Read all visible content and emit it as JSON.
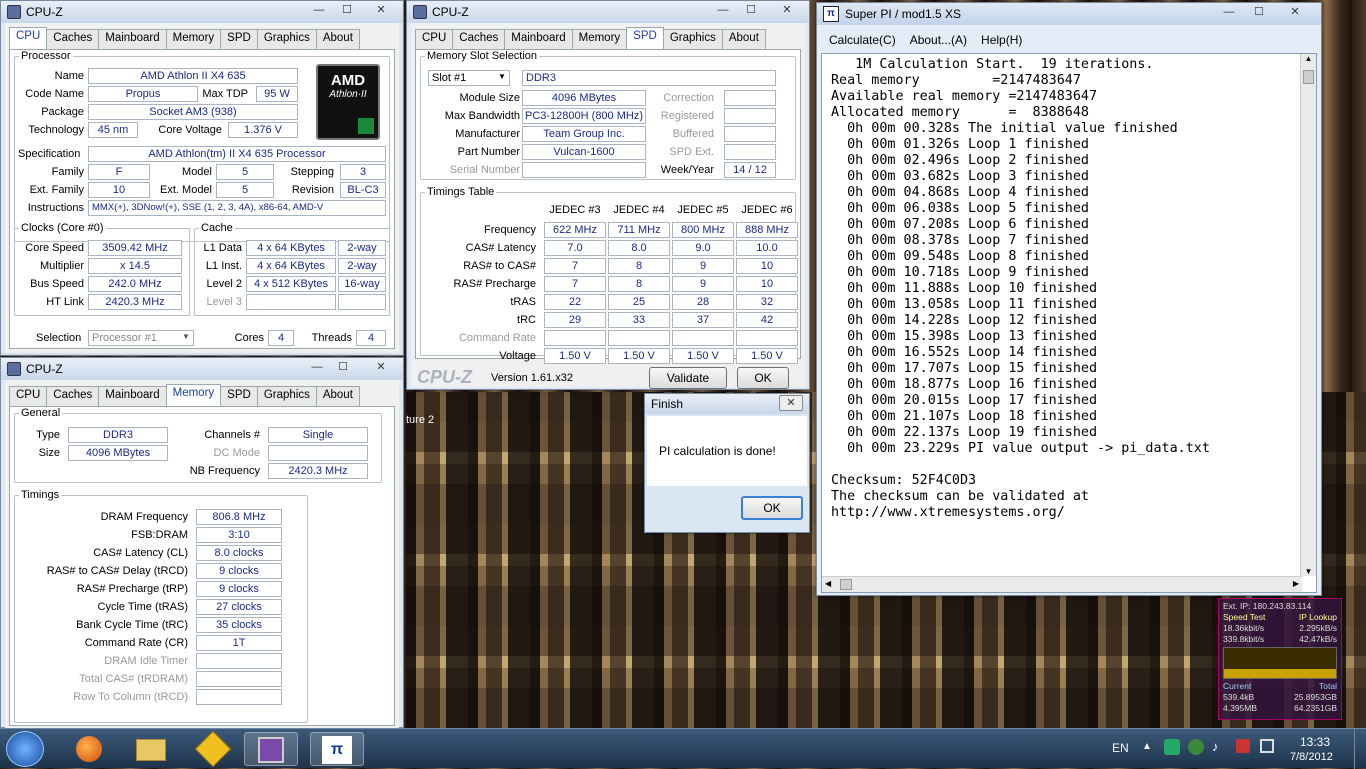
{
  "cpuz1": {
    "title": "CPU-Z",
    "tabs": [
      "CPU",
      "Caches",
      "Mainboard",
      "Memory",
      "SPD",
      "Graphics",
      "About"
    ],
    "active_tab": "CPU",
    "processor_legend": "Processor",
    "name_label": "Name",
    "name": "AMD Athlon II X4 635",
    "codename_label": "Code Name",
    "codename": "Propus",
    "maxtdp_label": "Max TDP",
    "maxtdp": "95 W",
    "package_label": "Package",
    "package": "Socket AM3 (938)",
    "technology_label": "Technology",
    "technology": "45 nm",
    "corevoltage_label": "Core Voltage",
    "corevoltage": "1.376 V",
    "spec_label": "Specification",
    "spec": "AMD Athlon(tm) II X4 635 Processor",
    "family_label": "Family",
    "family": "F",
    "model_label": "Model",
    "model": "5",
    "stepping_label": "Stepping",
    "stepping": "3",
    "extfamily_label": "Ext. Family",
    "extfamily": "10",
    "extmodel_label": "Ext. Model",
    "extmodel": "5",
    "revision_label": "Revision",
    "revision": "BL-C3",
    "instructions_label": "Instructions",
    "instructions": "MMX(+), 3DNow!(+), SSE (1, 2, 3, 4A), x86-64, AMD-V",
    "logo_brand": "AMD",
    "logo_sub": "Athlon·II",
    "clocks_legend": "Clocks (Core #0)",
    "corespeed_label": "Core Speed",
    "corespeed": "3509.42 MHz",
    "multiplier_label": "Multiplier",
    "multiplier": "x 14.5",
    "busspeed_label": "Bus Speed",
    "busspeed": "242.0 MHz",
    "htlink_label": "HT Link",
    "htlink": "2420.3 MHz",
    "cache_legend": "Cache",
    "l1data_label": "L1 Data",
    "l1data": "4 x 64 KBytes",
    "l1data_way": "2-way",
    "l1inst_label": "L1 Inst.",
    "l1inst": "4 x 64 KBytes",
    "l1inst_way": "2-way",
    "level2_label": "Level 2",
    "level2": "4 x 512 KBytes",
    "level2_way": "16-way",
    "level3_label": "Level 3",
    "selection_label": "Selection",
    "selection": "Processor #1",
    "cores_label": "Cores",
    "cores": "4",
    "threads_label": "Threads",
    "threads": "4"
  },
  "cpuz2": {
    "title": "CPU-Z",
    "tabs": [
      "CPU",
      "Caches",
      "Mainboard",
      "Memory",
      "SPD",
      "Graphics",
      "About"
    ],
    "active_tab": "SPD",
    "slot_legend": "Memory Slot Selection",
    "slot": "Slot #1",
    "slot_type": "DDR3",
    "modulesize_label": "Module Size",
    "modulesize": "4096 MBytes",
    "correction_label": "Correction",
    "maxbw_label": "Max Bandwidth",
    "maxbw": "PC3-12800H (800 MHz)",
    "registered_label": "Registered",
    "manufacturer_label": "Manufacturer",
    "manufacturer": "Team Group Inc.",
    "buffered_label": "Buffered",
    "partnumber_label": "Part Number",
    "partnumber": "Vulcan-1600",
    "spdext_label": "SPD Ext.",
    "serial_label": "Serial Number",
    "weekyear_label": "Week/Year",
    "weekyear": "14 / 12",
    "timings_legend": "Timings Table",
    "jedec_headers": [
      "JEDEC #3",
      "JEDEC #4",
      "JEDEC #5",
      "JEDEC #6"
    ],
    "rows": [
      {
        "label": "Frequency",
        "vals": [
          "622 MHz",
          "711 MHz",
          "800 MHz",
          "888 MHz"
        ]
      },
      {
        "label": "CAS# Latency",
        "vals": [
          "7.0",
          "8.0",
          "9.0",
          "10.0"
        ]
      },
      {
        "label": "RAS# to CAS#",
        "vals": [
          "7",
          "8",
          "9",
          "10"
        ]
      },
      {
        "label": "RAS# Precharge",
        "vals": [
          "7",
          "8",
          "9",
          "10"
        ]
      },
      {
        "label": "tRAS",
        "vals": [
          "22",
          "25",
          "28",
          "32"
        ]
      },
      {
        "label": "tRC",
        "vals": [
          "29",
          "33",
          "37",
          "42"
        ]
      },
      {
        "label": "Command Rate",
        "vals": [
          "",
          "",
          "",
          ""
        ]
      },
      {
        "label": "Voltage",
        "vals": [
          "1.50 V",
          "1.50 V",
          "1.50 V",
          "1.50 V"
        ]
      }
    ],
    "brand": "CPU-Z",
    "version": "Version 1.61.x32",
    "validate": "Validate",
    "ok": "OK"
  },
  "cpuz3": {
    "title": "CPU-Z",
    "tabs": [
      "CPU",
      "Caches",
      "Mainboard",
      "Memory",
      "SPD",
      "Graphics",
      "About"
    ],
    "active_tab": "Memory",
    "general_legend": "General",
    "type_label": "Type",
    "type": "DDR3",
    "size_label": "Size",
    "size": "4096 MBytes",
    "channels_label": "Channels #",
    "channels": "Single",
    "dcmode_label": "DC Mode",
    "nbfreq_label": "NB Frequency",
    "nbfreq": "2420.3 MHz",
    "timings_legend": "Timings",
    "rows": [
      {
        "label": "DRAM Frequency",
        "val": "806.8 MHz"
      },
      {
        "label": "FSB:DRAM",
        "val": "3:10"
      },
      {
        "label": "CAS# Latency (CL)",
        "val": "8.0 clocks"
      },
      {
        "label": "RAS# to CAS# Delay (tRCD)",
        "val": "9 clocks"
      },
      {
        "label": "RAS# Precharge (tRP)",
        "val": "9 clocks"
      },
      {
        "label": "Cycle Time (tRAS)",
        "val": "27 clocks"
      },
      {
        "label": "Bank Cycle Time (tRC)",
        "val": "35 clocks"
      },
      {
        "label": "Command Rate (CR)",
        "val": "1T"
      },
      {
        "label": "DRAM Idle Timer",
        "val": ""
      },
      {
        "label": "Total CAS# (tRDRAM)",
        "val": ""
      },
      {
        "label": "Row To Column (tRCD)",
        "val": ""
      }
    ]
  },
  "superpi": {
    "title": "Super PI / mod1.5 XS",
    "menu": [
      "Calculate(C)",
      "About...(A)",
      "Help(H)"
    ],
    "output": "   1M Calculation Start.  19 iterations.\nReal memory         =2147483647\nAvailable real memory =2147483647\nAllocated memory      =  8388648\n  0h 00m 00.328s The initial value finished\n  0h 00m 01.326s Loop 1 finished\n  0h 00m 02.496s Loop 2 finished\n  0h 00m 03.682s Loop 3 finished\n  0h 00m 04.868s Loop 4 finished\n  0h 00m 06.038s Loop 5 finished\n  0h 00m 07.208s Loop 6 finished\n  0h 00m 08.378s Loop 7 finished\n  0h 00m 09.548s Loop 8 finished\n  0h 00m 10.718s Loop 9 finished\n  0h 00m 11.888s Loop 10 finished\n  0h 00m 13.058s Loop 11 finished\n  0h 00m 14.228s Loop 12 finished\n  0h 00m 15.398s Loop 13 finished\n  0h 00m 16.552s Loop 14 finished\n  0h 00m 17.707s Loop 15 finished\n  0h 00m 18.877s Loop 16 finished\n  0h 00m 20.015s Loop 17 finished\n  0h 00m 21.107s Loop 18 finished\n  0h 00m 22.137s Loop 19 finished\n  0h 00m 23.229s PI value output -> pi_data.txt\n\nChecksum: 52F4C0D3\nThe checksum can be validated at\nhttp://www.xtremesystems.org/"
  },
  "finish": {
    "title": "Finish",
    "message": "PI calculation is done!",
    "ok": "OK"
  },
  "behind": {
    "ture_text": "ture 2"
  },
  "gadget": {
    "extip": "Ext. IP: 180.243.83.114",
    "speedtest": "Speed Test",
    "iplookup": "IP Lookup",
    "up": "18.36kbit/s",
    "upsz": "2.295kB/s",
    "down": "339.8kbit/s",
    "downsz": "42.47kB/s",
    "current": "Current",
    "total": "Total",
    "cur1": "539.4kB",
    "tot1": "25.8953GB",
    "cur2": "4.395MB",
    "tot2": "64.2351GB"
  },
  "taskbar": {
    "lang": "EN",
    "time": "13:33",
    "date": "7/8/2012"
  }
}
